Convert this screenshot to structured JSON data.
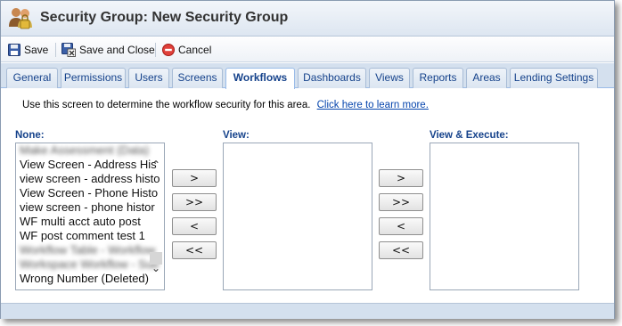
{
  "window": {
    "title": "Security Group: New Security Group"
  },
  "toolbar": {
    "save_label": "Save",
    "save_close_label": "Save and Close",
    "cancel_label": "Cancel"
  },
  "tabs": [
    {
      "label": "General"
    },
    {
      "label": "Permissions"
    },
    {
      "label": "Users"
    },
    {
      "label": "Screens"
    },
    {
      "label": "Workflows"
    },
    {
      "label": "Dashboards"
    },
    {
      "label": "Views"
    },
    {
      "label": "Reports"
    },
    {
      "label": "Areas"
    },
    {
      "label": "Lending Settings"
    }
  ],
  "active_tab": "Workflows",
  "info": {
    "text": "Use this screen to determine the workflow security for this area.",
    "link": "Click here to learn more."
  },
  "lists": {
    "none": {
      "label": "None:",
      "items": [
        "Make Assessment (Data)",
        "View Screen - Address His",
        "view screen - address histo",
        "View Screen - Phone Histo",
        "view screen - phone histor",
        "WF multi acct auto post",
        "WF post comment test 1",
        "Workflow Table - Workflow",
        "Workspace Workflow - Sub",
        "Wrong Number (Deleted)"
      ]
    },
    "view": {
      "label": "View:"
    },
    "view_execute": {
      "label": "View & Execute:"
    }
  },
  "move_buttons": {
    "add": ">",
    "add_all": ">>",
    "remove": "<",
    "remove_all": "<<"
  },
  "colors": {
    "accent": "#15428b",
    "tab_bar": "#d4e0ee",
    "link": "#0645ad"
  }
}
